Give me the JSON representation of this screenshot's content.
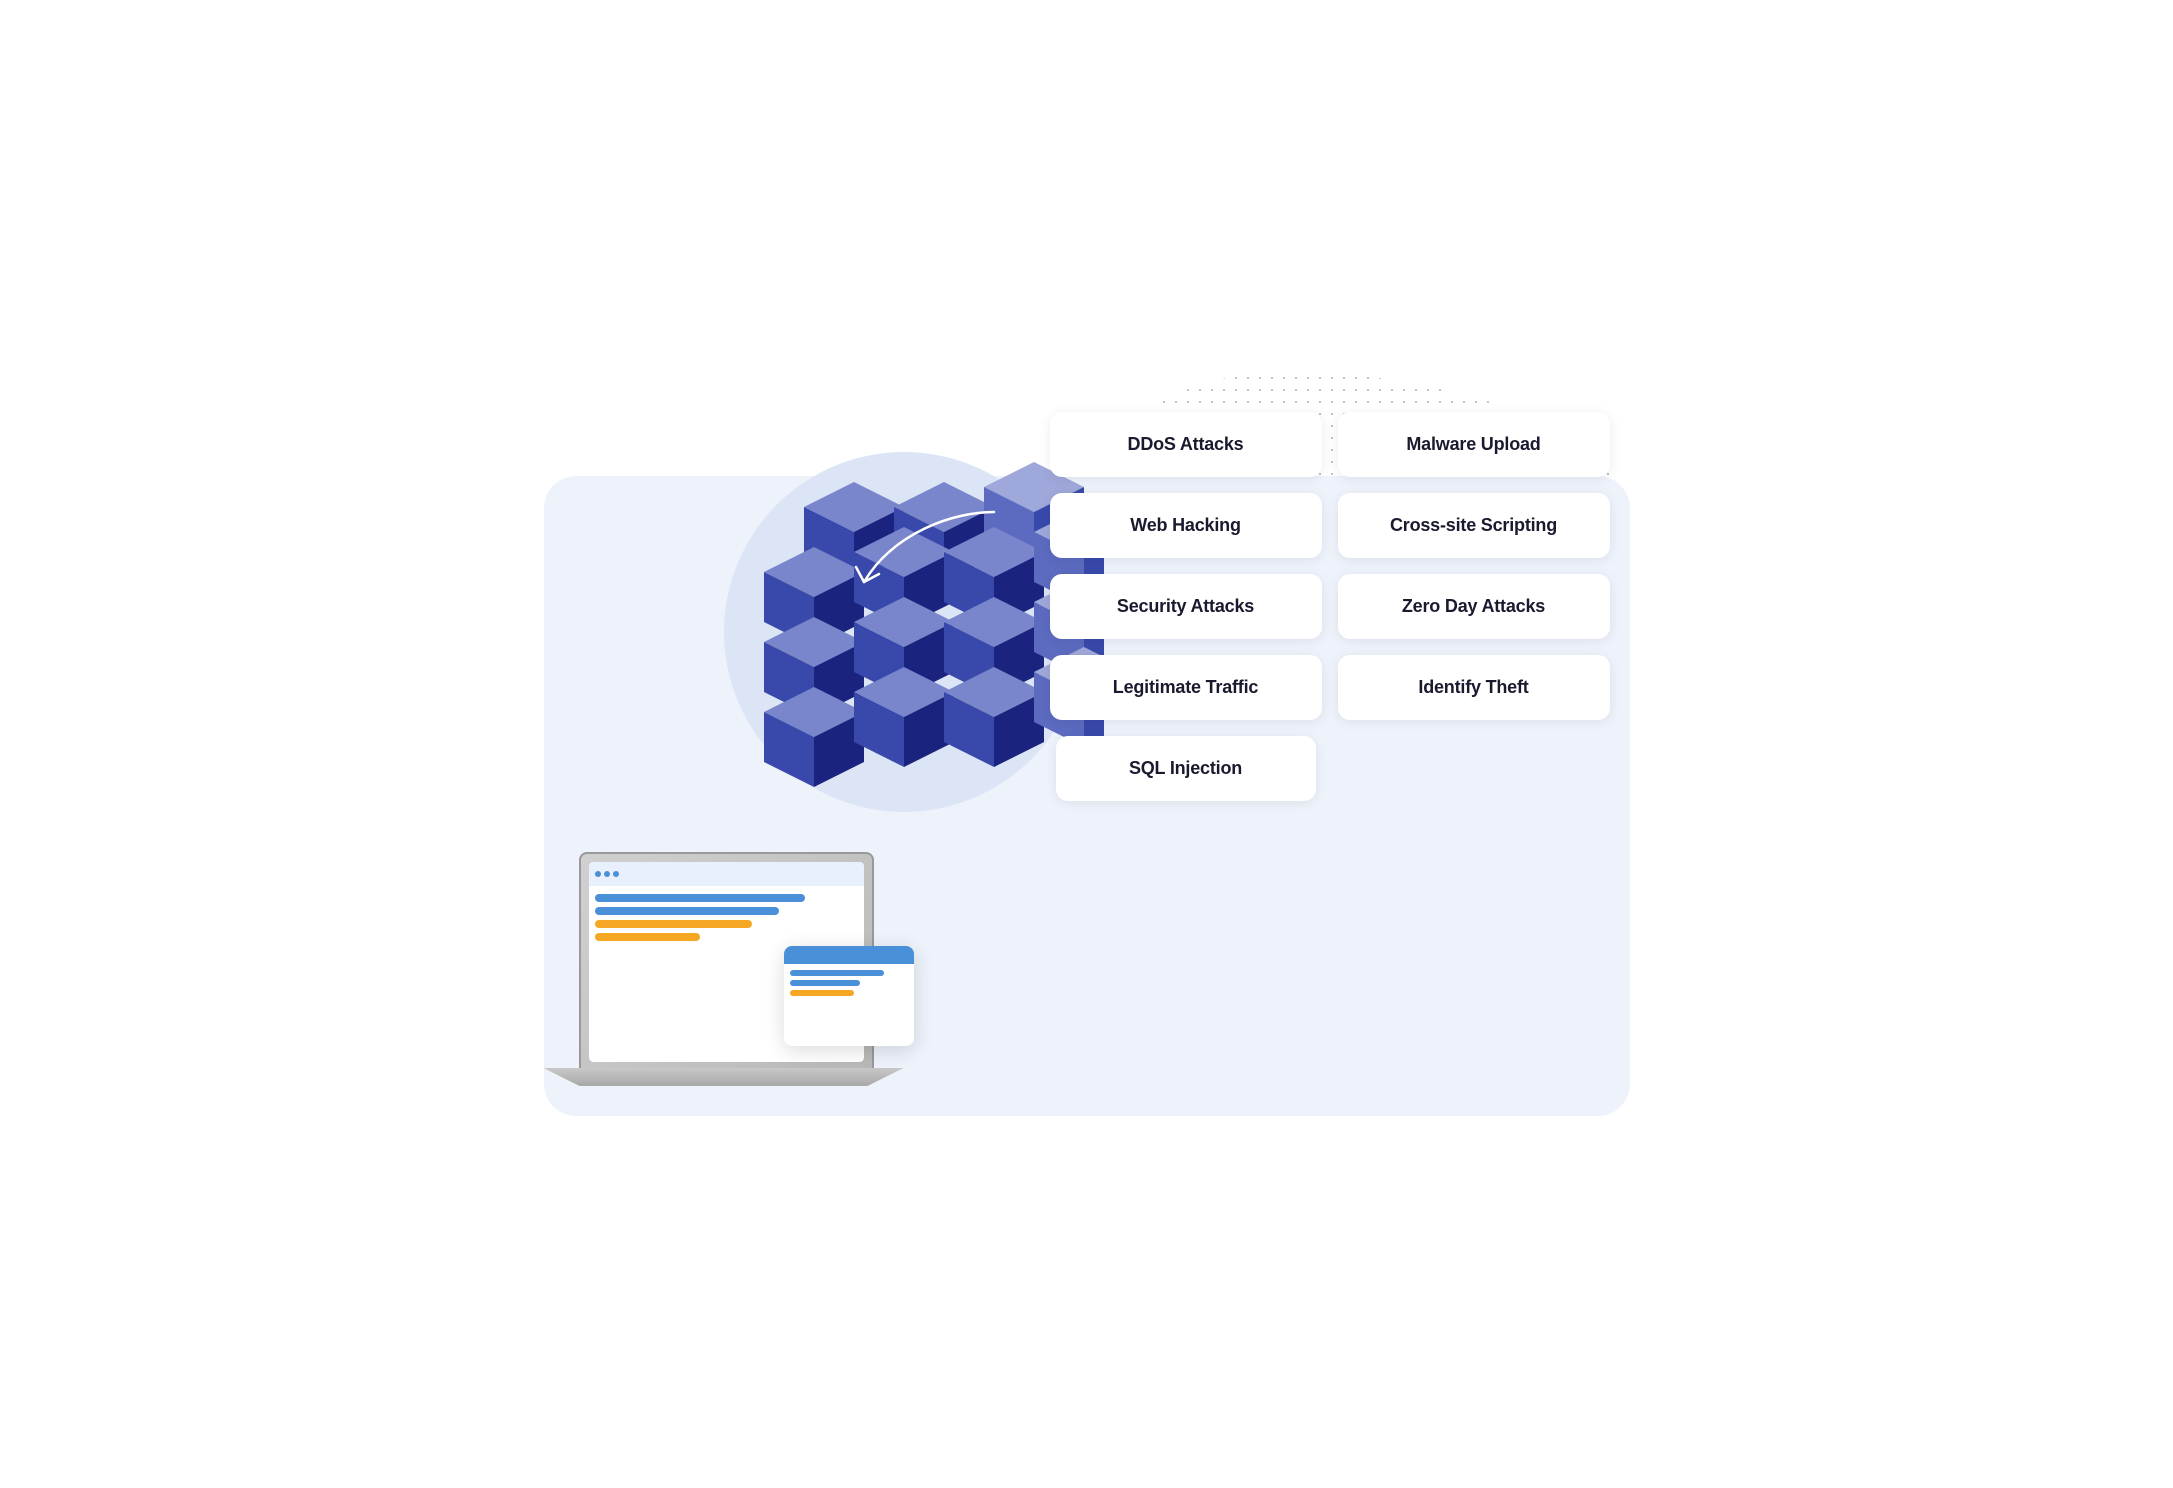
{
  "scene": {
    "tags": [
      {
        "id": "ddos",
        "label": "DDoS Attacks",
        "row": 0,
        "col": 0
      },
      {
        "id": "malware",
        "label": "Malware Upload",
        "row": 0,
        "col": 1
      },
      {
        "id": "web-hacking",
        "label": "Web Hacking",
        "row": 1,
        "col": 0
      },
      {
        "id": "cross-site",
        "label": "Cross-site Scripting",
        "row": 1,
        "col": 1
      },
      {
        "id": "security-attacks",
        "label": "Security Attacks",
        "row": 2,
        "col": 0
      },
      {
        "id": "zero-day",
        "label": "Zero Day Attacks",
        "row": 2,
        "col": 1
      },
      {
        "id": "legitimate",
        "label": "Legitimate Traffic",
        "row": 3,
        "col": 0
      },
      {
        "id": "identify-theft",
        "label": "Identify Theft",
        "row": 3,
        "col": 1
      },
      {
        "id": "sql-injection",
        "label": "SQL Injection",
        "row": 4,
        "col": "center"
      }
    ],
    "colors": {
      "card_bg": "#eef2fb",
      "circle_bg": "#dce5f5",
      "tag_bg": "#ffffff",
      "firewall_dark": "#1a237e",
      "firewall_mid": "#3949ab",
      "firewall_light": "#7986cb",
      "browser_blue": "#4a90d9",
      "accent_orange": "#f5a623"
    }
  }
}
